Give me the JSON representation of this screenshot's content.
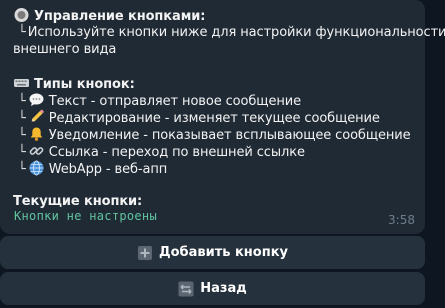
{
  "message": {
    "header": "Управление кнопками:",
    "description_1": "Используйте кнопки ниже для настройки функциональности и",
    "description_2": "внешнего вида",
    "types_title": "Типы кнопок:",
    "types": [
      {
        "icon": "speech-bubble-icon",
        "text": "Текст - отправляет новое сообщение"
      },
      {
        "icon": "pencil-icon",
        "text": "Редактирование - изменяет текущее сообщение"
      },
      {
        "icon": "bell-icon",
        "text": "Уведомление - показывает всплывающее сообщение"
      },
      {
        "icon": "link-icon",
        "text": "Ссылка - переход по внешней ссылке"
      },
      {
        "icon": "globe-icon",
        "text": "WebApp - веб-апп"
      }
    ],
    "current_title": "Текущие кнопки:",
    "current_value": "Кнопки не настроены",
    "time": "3:58"
  },
  "keyboard": {
    "add_label": "Добавить кнопку",
    "back_label": "Назад"
  },
  "colors": {
    "background": "#0e1621",
    "bubble": "#1f2a35",
    "button": "#25313d",
    "mono_text": "#61c39d",
    "time": "#6f7d8b"
  }
}
